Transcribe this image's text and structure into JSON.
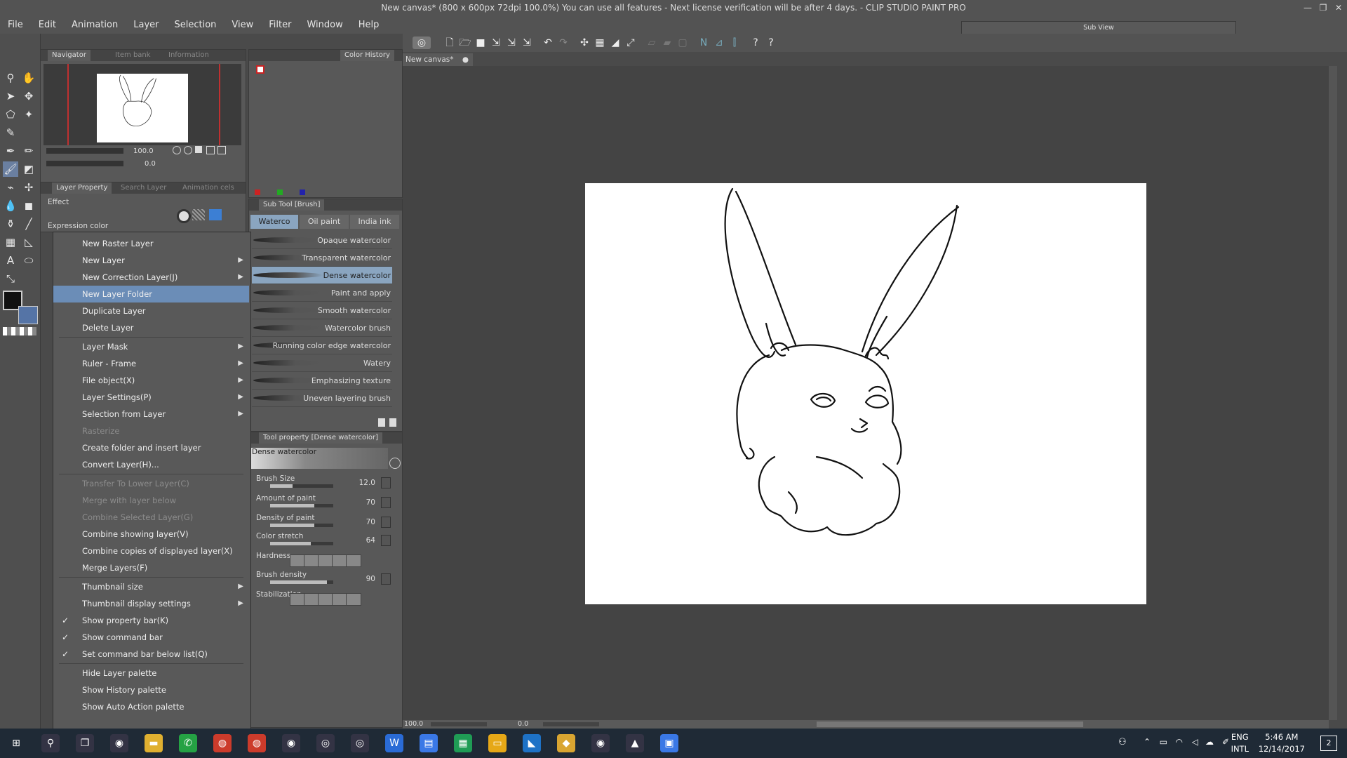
{
  "window": {
    "title": "New canvas* (800 x 600px 72dpi 100.0%)  You can use all features - Next license verification will be after 4 days. - CLIP STUDIO PAINT PRO",
    "btn_min": "—",
    "btn_max": "❐",
    "btn_close": "✕"
  },
  "menu": [
    "File",
    "Edit",
    "Animation",
    "Layer",
    "Selection",
    "View",
    "Filter",
    "Window",
    "Help"
  ],
  "navigator": {
    "tabs": [
      "Navigator",
      "Item bank",
      "Information"
    ],
    "zoom": "100.0",
    "rotation": "0.0"
  },
  "layer_panel": {
    "tabs": [
      "Layer Property",
      "Search Layer",
      "Animation cels"
    ],
    "effect_label": "Effect",
    "expression_label": "Expression color"
  },
  "color_history": {
    "tab": "Color History"
  },
  "sub_tool": {
    "header": "Sub Tool [Brush]",
    "groups": [
      "Waterco",
      "Oil paint",
      "India ink"
    ],
    "brushes": [
      "Opaque watercolor",
      "Transparent watercolor",
      "Dense watercolor",
      "Paint and apply",
      "Smooth watercolor",
      "Watercolor brush",
      "Running color edge watercolor",
      "Watery",
      "Emphasizing texture",
      "Uneven layering brush"
    ],
    "selected_index": 2
  },
  "tool_property": {
    "header": "Tool property [Dense watercolor]",
    "preview_label": "Dense watercolor",
    "props": [
      {
        "label": "Brush Size",
        "value": "12.0",
        "level": 0.35
      },
      {
        "label": "Amount of paint",
        "value": "70",
        "level": 0.7
      },
      {
        "label": "Density of paint",
        "value": "70",
        "level": 0.7
      },
      {
        "label": "Color stretch",
        "value": "64",
        "level": 0.64
      },
      {
        "label": "Hardness",
        "value": ""
      },
      {
        "label": "Brush density",
        "value": "90",
        "level": 0.9
      },
      {
        "label": "Stabilization",
        "value": ""
      }
    ]
  },
  "context_menu": {
    "items": [
      {
        "label": "New Raster Layer",
        "arrow": false,
        "disabled": false,
        "check": false
      },
      {
        "label": "New Layer",
        "arrow": true,
        "disabled": false,
        "check": false
      },
      {
        "label": "New Correction Layer(J)",
        "arrow": true,
        "disabled": false,
        "check": false
      },
      {
        "label": "New Layer Folder",
        "arrow": false,
        "disabled": false,
        "check": false,
        "highlight": true
      },
      {
        "label": "Duplicate Layer",
        "arrow": false,
        "disabled": false,
        "check": false
      },
      {
        "label": "Delete Layer",
        "arrow": false,
        "disabled": false,
        "check": false
      },
      {
        "sep": true
      },
      {
        "label": "Layer Mask",
        "arrow": true,
        "disabled": false,
        "check": false
      },
      {
        "label": "Ruler - Frame",
        "arrow": true,
        "disabled": false,
        "check": false
      },
      {
        "label": "File object(X)",
        "arrow": true,
        "disabled": false,
        "check": false
      },
      {
        "label": "Layer Settings(P)",
        "arrow": true,
        "disabled": false,
        "check": false
      },
      {
        "label": "Selection from Layer",
        "arrow": true,
        "disabled": false,
        "check": false
      },
      {
        "label": "Rasterize",
        "arrow": false,
        "disabled": true,
        "check": false
      },
      {
        "label": "Create folder and insert layer",
        "arrow": false,
        "disabled": false,
        "check": false
      },
      {
        "label": "Convert Layer(H)...",
        "arrow": false,
        "disabled": false,
        "check": false
      },
      {
        "sep": true
      },
      {
        "label": "Transfer To Lower Layer(C)",
        "arrow": false,
        "disabled": true,
        "check": false
      },
      {
        "label": "Merge with layer below",
        "arrow": false,
        "disabled": true,
        "check": false
      },
      {
        "label": "Combine Selected Layer(G)",
        "arrow": false,
        "disabled": true,
        "check": false
      },
      {
        "label": "Combine showing layer(V)",
        "arrow": false,
        "disabled": false,
        "check": false
      },
      {
        "label": "Combine copies of displayed layer(X)",
        "arrow": false,
        "disabled": false,
        "check": false
      },
      {
        "label": "Merge Layers(F)",
        "arrow": false,
        "disabled": false,
        "check": false
      },
      {
        "sep": true
      },
      {
        "label": "Thumbnail size",
        "arrow": true,
        "disabled": false,
        "check": false
      },
      {
        "label": "Thumbnail display settings",
        "arrow": true,
        "disabled": false,
        "check": false
      },
      {
        "label": "Show property bar(K)",
        "arrow": false,
        "disabled": false,
        "check": true
      },
      {
        "label": "Show command bar",
        "arrow": false,
        "disabled": false,
        "check": true
      },
      {
        "label": "Set command bar below list(Q)",
        "arrow": false,
        "disabled": false,
        "check": true
      },
      {
        "sep": true
      },
      {
        "label": "Hide Layer palette",
        "arrow": false,
        "disabled": false,
        "check": false
      },
      {
        "label": "Show History palette",
        "arrow": false,
        "disabled": false,
        "check": false
      },
      {
        "label": "Show Auto Action palette",
        "arrow": false,
        "disabled": false,
        "check": false
      }
    ]
  },
  "canvas": {
    "tab": "New canvas*",
    "zoom": "100.0",
    "angle": "0.0"
  },
  "sub_view": {
    "title": "Sub View"
  },
  "taskbar": {
    "apps": [
      "start-icon",
      "search-icon",
      "task-view-icon",
      "app-icon",
      "file-explorer-icon",
      "whatsapp-icon",
      "chrome-icon",
      "chrome-icon",
      "app-icon",
      "clip-studio-icon",
      "clip-studio-icon",
      "writer-icon",
      "docs-icon",
      "sheets-icon",
      "slides-icon",
      "vscode-icon",
      "git-icon",
      "app-icon",
      "photos-icon",
      "store-icon"
    ],
    "lang_top": "ENG",
    "lang_bottom": "INTL",
    "time": "5:46 AM",
    "date": "12/14/2017",
    "notif_count": "2"
  },
  "colors": {
    "accent": "#6b8db7",
    "panel": "#585858",
    "menu_bg": "#535353",
    "canvas_bg": "#444444",
    "taskbar": "#1f2a36"
  }
}
